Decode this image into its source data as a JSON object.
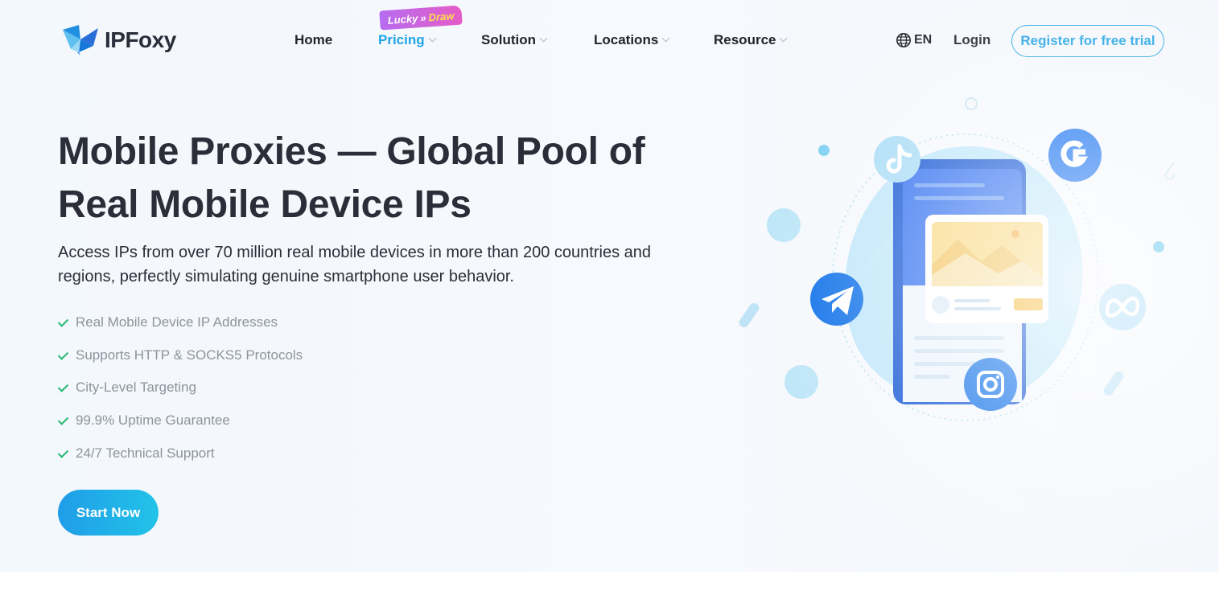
{
  "brand": {
    "name": "IPFoxy"
  },
  "nav": {
    "items": [
      {
        "label": "Home",
        "has_dropdown": false,
        "active": false
      },
      {
        "label": "Pricing",
        "has_dropdown": true,
        "active": true
      },
      {
        "label": "Solution",
        "has_dropdown": true,
        "active": false
      },
      {
        "label": "Locations",
        "has_dropdown": true,
        "active": false
      },
      {
        "label": "Resource",
        "has_dropdown": true,
        "active": false
      }
    ],
    "badge": {
      "part1": "Lucky",
      "separator": "»",
      "part2": "Draw"
    },
    "language": "EN",
    "login_label": "Login",
    "register_label": "Register for free trial"
  },
  "hero": {
    "title_line1": "Mobile Proxies — Global Pool of",
    "title_line2": "Real Mobile Device IPs",
    "description_line1": "Access IPs from over 70 million real mobile devices in more than 200 countries and",
    "description_line2": "regions, perfectly simulating genuine smartphone user behavior.",
    "features": [
      "Real Mobile Device IP Addresses",
      "Supports HTTP & SOCKS5 Protocols",
      "City-Level Targeting",
      "99.9% Uptime Guarantee",
      "24/7 Technical Support"
    ],
    "cta_label": "Start Now"
  },
  "illustration": {
    "icons": [
      "tiktok-icon",
      "google-icon",
      "telegram-icon",
      "meta-icon",
      "instagram-icon"
    ]
  },
  "colors": {
    "accent": "#1ea2e6",
    "text_dark": "#2b2d38",
    "text_muted": "#8e939d",
    "check": "#2bb673",
    "badge_gradient": [
      "#b66cf0",
      "#e55cc8"
    ]
  }
}
